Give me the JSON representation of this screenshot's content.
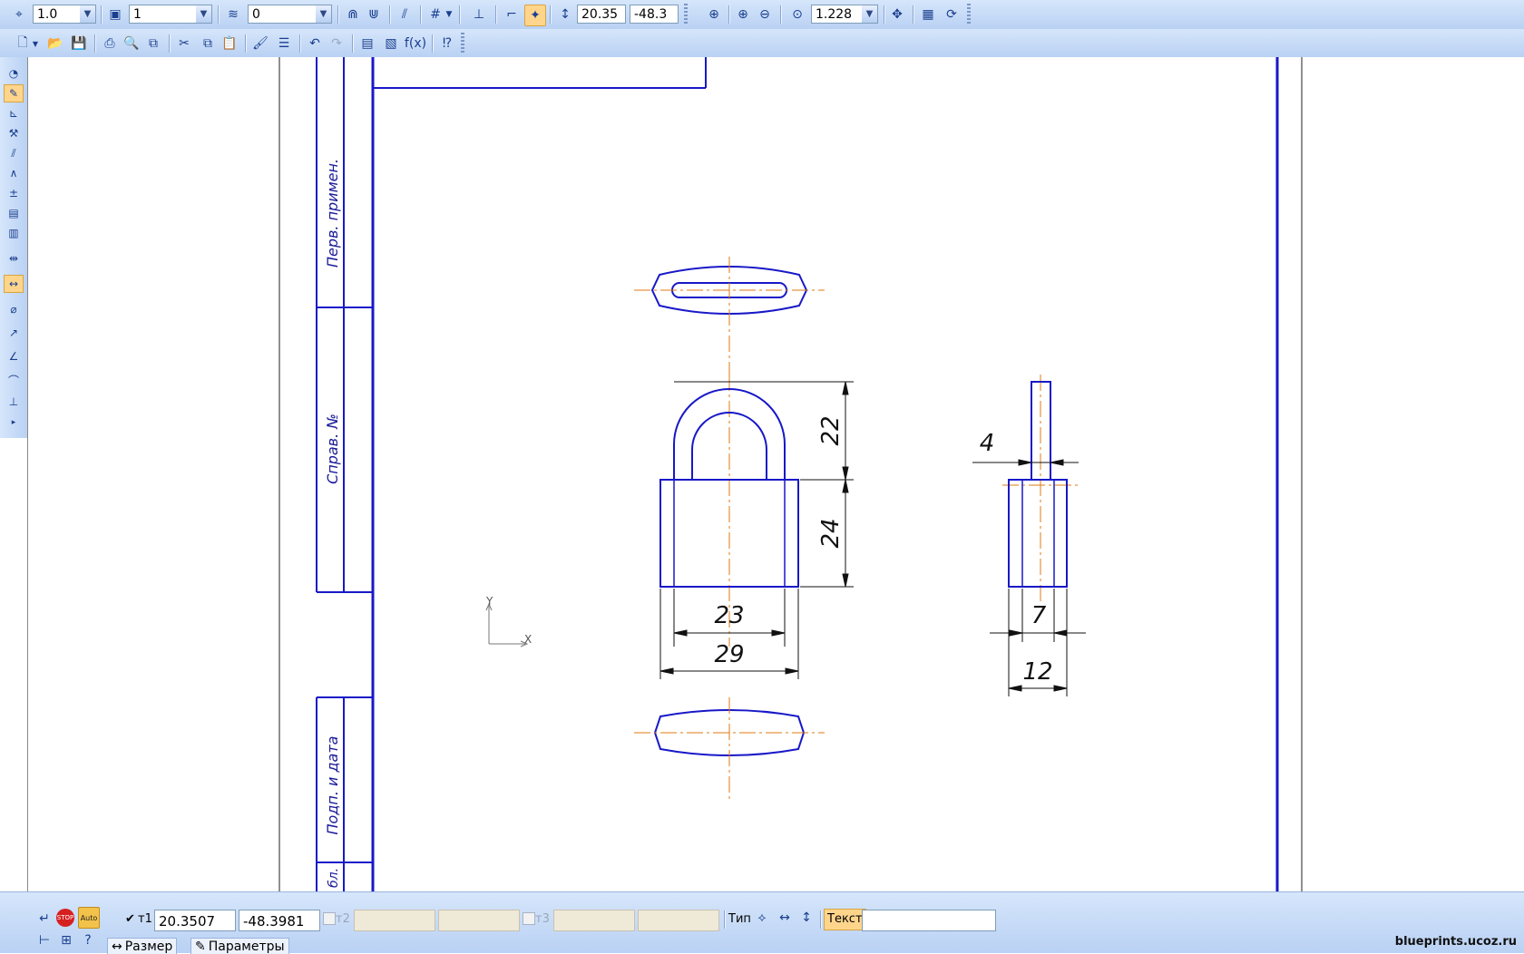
{
  "toolbar_top": {
    "scale_value": "1.0",
    "style_value": "1",
    "layer_value": "0",
    "cursor_x": "20.35",
    "cursor_y": "-48.3",
    "zoom_value": "1.228"
  },
  "toolbar_std": {
    "fx_label": "f(x)"
  },
  "drawing": {
    "stamp_labels": [
      "Перв. примен.",
      "Справ. №",
      "Подп. и дата",
      "бл."
    ],
    "axis_x": "X",
    "axis_y": "Y",
    "dims": {
      "shackle_height": "22",
      "body_height": "24",
      "inner_width": "23",
      "outer_width": "29",
      "shackle_thickness": "4",
      "body_depth_inner": "7",
      "body_depth_outer": "12"
    }
  },
  "bottom_panel": {
    "t1_label": "т1",
    "t1_x": "20.3507",
    "t1_y": "-48.3981",
    "t2_label": "т2",
    "t3_label": "т3",
    "type_label": "Тип",
    "text_label": "Текст",
    "tab_size": "Размер",
    "tab_params": "Параметры",
    "stop_label": "STOP",
    "auto_label": "Auto"
  },
  "watermark": "blueprints.ucoz.ru",
  "colors": {
    "drawing_line": "#1818c8",
    "axis_line": "#e07a10",
    "toolbar_bg": "#c7dbf6",
    "active_tool": "#ffd58c"
  }
}
